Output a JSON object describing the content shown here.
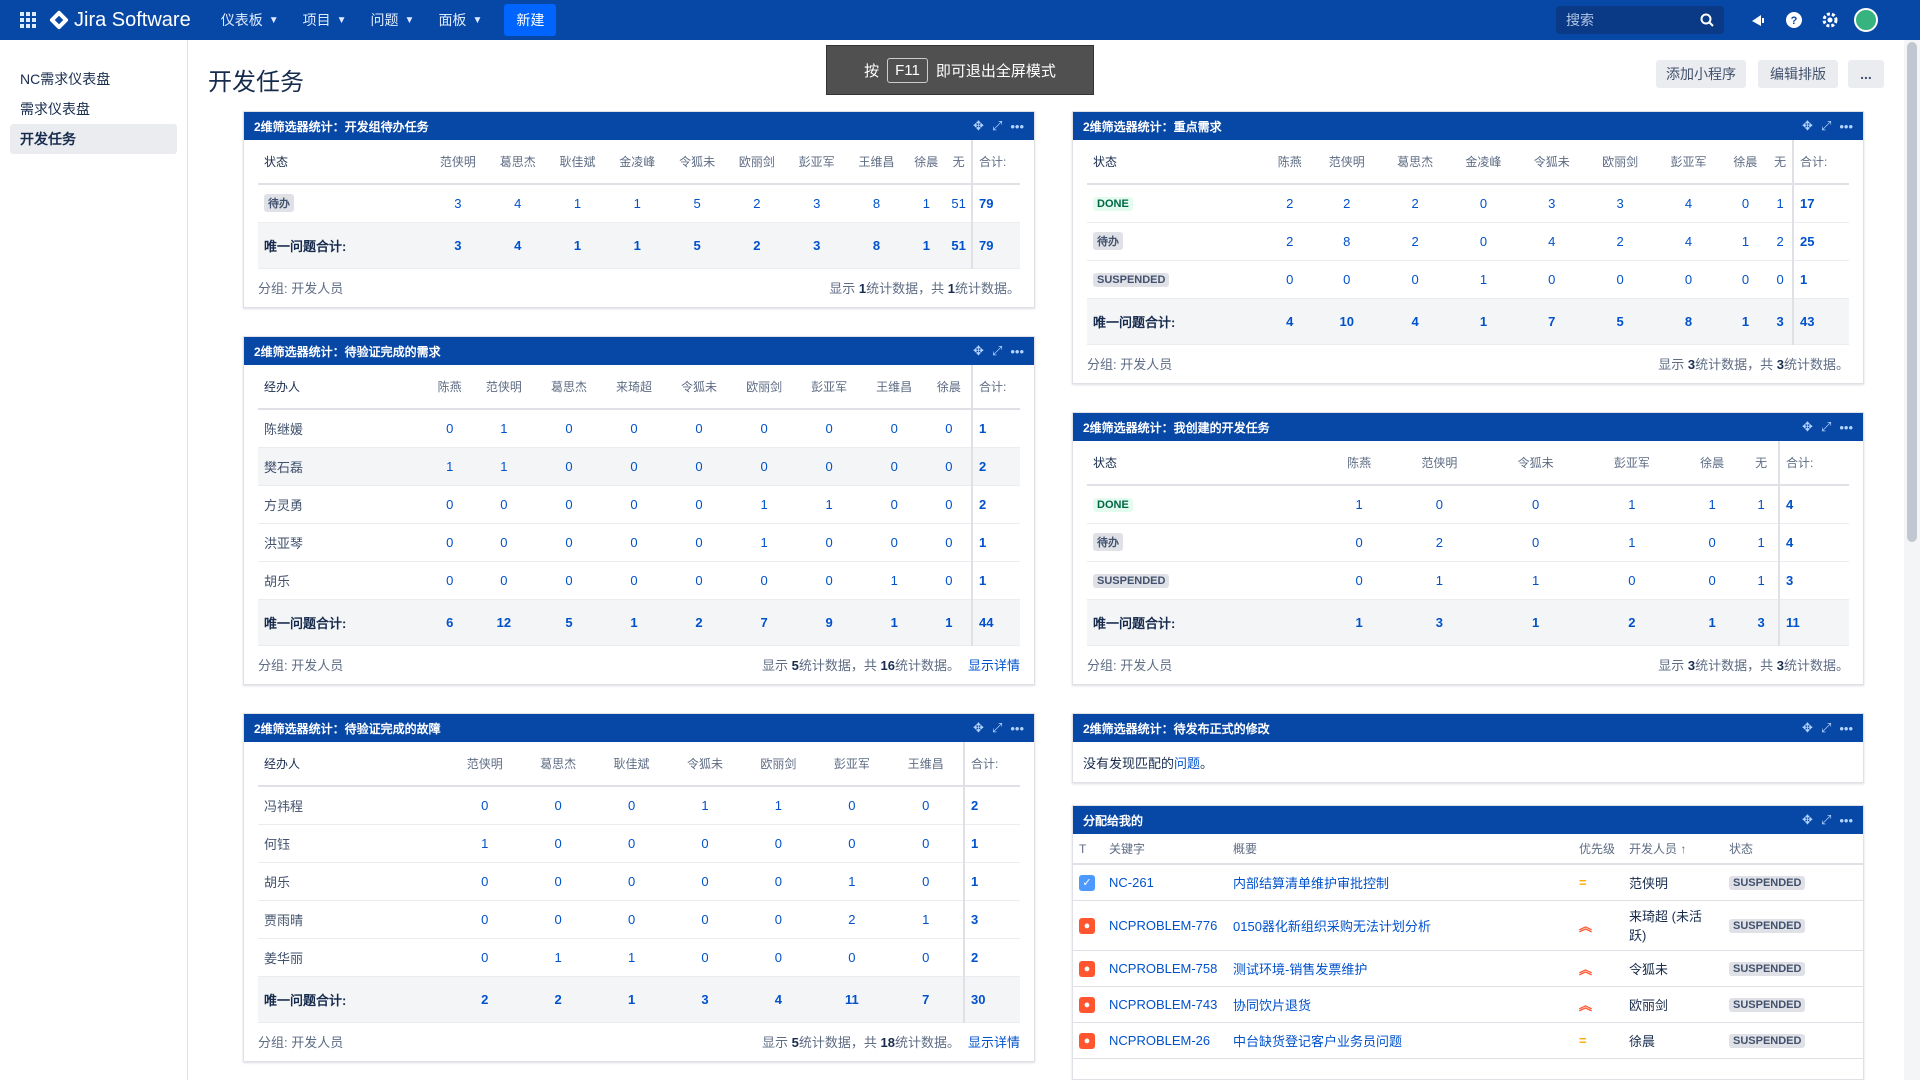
{
  "topnav": {
    "product_name": "Jira Software",
    "menus": [
      "仪表板",
      "项目",
      "问题",
      "面板"
    ],
    "create_label": "新建",
    "search_placeholder": "搜索"
  },
  "sidebar": {
    "items": [
      {
        "label": "NC需求仪表盘",
        "active": false
      },
      {
        "label": "需求仪表盘",
        "active": false
      },
      {
        "label": "开发任务",
        "active": true
      }
    ]
  },
  "page": {
    "title": "开发任务",
    "toast_prefix": "按",
    "toast_key": "F11",
    "toast_suffix": "即可退出全屏模式",
    "add_gadget_label": "添加小程序",
    "edit_layout_label": "编辑排版",
    "more_label": "..."
  },
  "gadgets": {
    "g1": {
      "title": "2维筛选器统计：开发组待办任务",
      "row_header": "状态",
      "columns": [
        "范侠明",
        "葛思杰",
        "耿佳斌",
        "金凌峰",
        "令狐未",
        "欧丽剑",
        "彭亚军",
        "王维昌",
        "徐晨",
        "无"
      ],
      "total_label": "合计:",
      "rows": [
        {
          "label": "待办",
          "values": [
            "3",
            "4",
            "1",
            "1",
            "5",
            "2",
            "3",
            "8",
            "1",
            "51"
          ],
          "total": "79"
        }
      ],
      "sum_label": "唯一问题合计:",
      "sums": [
        "3",
        "4",
        "1",
        "1",
        "5",
        "2",
        "3",
        "8",
        "1",
        "51"
      ],
      "sum_total": "79",
      "footer_group": "分组: 开发人员",
      "footer_shown": "1",
      "footer_total": "1"
    },
    "g2": {
      "title": "2维筛选器统计：待验证完成的需求",
      "row_header": "经办人",
      "columns": [
        "陈燕",
        "范侠明",
        "葛思杰",
        "来琦超",
        "令狐未",
        "欧丽剑",
        "彭亚军",
        "王维昌",
        "徐晨"
      ],
      "total_label": "合计:",
      "rows": [
        {
          "label": "陈继媛",
          "values": [
            "0",
            "1",
            "0",
            "0",
            "0",
            "0",
            "0",
            "0",
            "0"
          ],
          "total": "1"
        },
        {
          "label": "樊石磊",
          "values": [
            "1",
            "1",
            "0",
            "0",
            "0",
            "0",
            "0",
            "0",
            "0"
          ],
          "total": "2"
        },
        {
          "label": "方灵勇",
          "values": [
            "0",
            "0",
            "0",
            "0",
            "0",
            "1",
            "1",
            "0",
            "0"
          ],
          "total": "2"
        },
        {
          "label": "洪亚琴",
          "values": [
            "0",
            "0",
            "0",
            "0",
            "0",
            "1",
            "0",
            "0",
            "0"
          ],
          "total": "1"
        },
        {
          "label": "胡乐",
          "values": [
            "0",
            "0",
            "0",
            "0",
            "0",
            "0",
            "0",
            "1",
            "0"
          ],
          "total": "1"
        }
      ],
      "sum_label": "唯一问题合计:",
      "sums": [
        "6",
        "12",
        "5",
        "1",
        "2",
        "7",
        "9",
        "1",
        "1"
      ],
      "sum_total": "44",
      "footer_group": "分组: 开发人员",
      "footer_shown": "5",
      "footer_total": "16",
      "details_link": "显示详情"
    },
    "g3": {
      "title": "2维筛选器统计：待验证完成的故障",
      "row_header": "经办人",
      "columns": [
        "范侠明",
        "葛思杰",
        "耿佳斌",
        "令狐未",
        "欧丽剑",
        "彭亚军",
        "王维昌"
      ],
      "total_label": "合计:",
      "rows": [
        {
          "label": "冯祎程",
          "values": [
            "0",
            "0",
            "0",
            "1",
            "1",
            "0",
            "0"
          ],
          "total": "2"
        },
        {
          "label": "何钰",
          "values": [
            "1",
            "0",
            "0",
            "0",
            "0",
            "0",
            "0"
          ],
          "total": "1"
        },
        {
          "label": "胡乐",
          "values": [
            "0",
            "0",
            "0",
            "0",
            "0",
            "1",
            "0"
          ],
          "total": "1"
        },
        {
          "label": "贾雨晴",
          "values": [
            "0",
            "0",
            "0",
            "0",
            "0",
            "2",
            "1"
          ],
          "total": "3"
        },
        {
          "label": "姜华丽",
          "values": [
            "0",
            "1",
            "1",
            "0",
            "0",
            "0",
            "0"
          ],
          "total": "2"
        }
      ],
      "sum_label": "唯一问题合计:",
      "sums": [
        "2",
        "2",
        "1",
        "3",
        "4",
        "11",
        "7"
      ],
      "sum_total": "30",
      "footer_group": "分组: 开发人员",
      "footer_shown": "5",
      "footer_total": "18",
      "details_link": "显示详情"
    },
    "g4": {
      "title": "2维筛选器统计：重点需求",
      "row_header": "状态",
      "columns": [
        "陈燕",
        "范侠明",
        "葛思杰",
        "金凌峰",
        "令狐未",
        "欧丽剑",
        "彭亚军",
        "徐晨",
        "无"
      ],
      "total_label": "合计:",
      "rows": [
        {
          "label": "DONE",
          "type": "done",
          "values": [
            "2",
            "2",
            "2",
            "0",
            "3",
            "3",
            "4",
            "0",
            "1"
          ],
          "total": "17"
        },
        {
          "label": "待办",
          "type": "gray",
          "values": [
            "2",
            "8",
            "2",
            "0",
            "4",
            "2",
            "4",
            "1",
            "2"
          ],
          "total": "25"
        },
        {
          "label": "SUSPENDED",
          "type": "gray",
          "values": [
            "0",
            "0",
            "0",
            "1",
            "0",
            "0",
            "0",
            "0",
            "0"
          ],
          "total": "1"
        }
      ],
      "sum_label": "唯一问题合计:",
      "sums": [
        "4",
        "10",
        "4",
        "1",
        "7",
        "5",
        "8",
        "1",
        "3"
      ],
      "sum_total": "43",
      "footer_group": "分组: 开发人员",
      "footer_shown": "3",
      "footer_total": "3"
    },
    "g5": {
      "title": "2维筛选器统计：我创建的开发任务",
      "row_header": "状态",
      "columns": [
        "陈燕",
        "范侠明",
        "令狐未",
        "彭亚军",
        "徐晨",
        "无"
      ],
      "total_label": "合计:",
      "rows": [
        {
          "label": "DONE",
          "type": "done",
          "values": [
            "1",
            "0",
            "0",
            "1",
            "1",
            "1"
          ],
          "total": "4"
        },
        {
          "label": "待办",
          "type": "gray",
          "values": [
            "0",
            "2",
            "0",
            "1",
            "0",
            "1"
          ],
          "total": "4"
        },
        {
          "label": "SUSPENDED",
          "type": "gray",
          "values": [
            "0",
            "1",
            "1",
            "0",
            "0",
            "1"
          ],
          "total": "3"
        }
      ],
      "sum_label": "唯一问题合计:",
      "sums": [
        "1",
        "3",
        "1",
        "2",
        "1",
        "3"
      ],
      "sum_total": "11",
      "footer_group": "分组: 开发人员",
      "footer_shown": "3",
      "footer_total": "3"
    },
    "g6": {
      "title": "2维筛选器统计：待发布正式的修改",
      "empty_prefix": "没有发现匹配的",
      "empty_link": "问题",
      "empty_suffix": "。"
    },
    "g7": {
      "title": "分配给我的",
      "headers": {
        "t": "T",
        "key": "关键字",
        "summary": "概要",
        "priority": "优先级",
        "assignee": "开发人员",
        "status": "状态"
      },
      "sort_arrow": "↑",
      "rows": [
        {
          "type": "task",
          "key": "NC-261",
          "summary": "内部结算清单维护审批控制",
          "priority": "medium",
          "priority_glyph": "=",
          "assignee": "范侠明",
          "status": "SUSPENDED"
        },
        {
          "type": "problem",
          "key": "NCPROBLEM-776",
          "summary": "0150器化新组织采购无法计划分析",
          "priority": "high",
          "priority_glyph": "︽",
          "assignee": "来琦超 (未活跃)",
          "status": "SUSPENDED"
        },
        {
          "type": "problem",
          "key": "NCPROBLEM-758",
          "summary": "测试环境-销售发票维护",
          "priority": "high",
          "priority_glyph": "︽",
          "assignee": "令狐未",
          "status": "SUSPENDED"
        },
        {
          "type": "problem",
          "key": "NCPROBLEM-743",
          "summary": "协同饮片退货",
          "priority": "high",
          "priority_glyph": "︽",
          "assignee": "欧丽剑",
          "status": "SUSPENDED"
        },
        {
          "type": "problem",
          "key": "NCPROBLEM-26",
          "summary": "中台缺货登记客户业务员问题",
          "priority": "medium",
          "priority_glyph": "=",
          "assignee": "徐晨",
          "status": "SUSPENDED"
        }
      ]
    }
  },
  "footer_text": {
    "show_prefix": "显示 ",
    "show_mid": "统计数据，共 ",
    "show_suffix": "统计数据。"
  },
  "colors": {
    "nav_bg": "#0747a6",
    "link": "#0052cc",
    "priority_medium": "#ffab00",
    "priority_high": "#ff5630"
  }
}
